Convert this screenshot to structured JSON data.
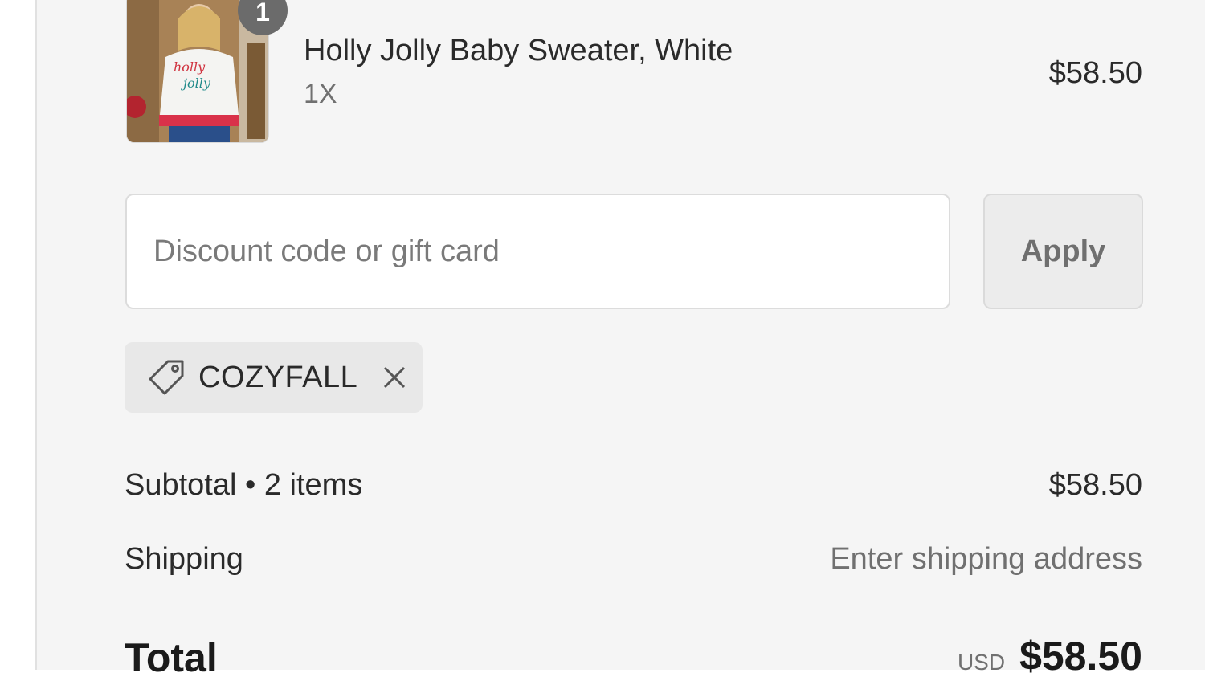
{
  "product": {
    "quantity": "1",
    "name": "Holly Jolly Baby Sweater, White",
    "variant": "1X",
    "price": "$58.50",
    "image_icon": "sweater-photo"
  },
  "discount": {
    "placeholder": "Discount code or gift card",
    "value": "",
    "apply_label": "Apply",
    "applied_code": "COZYFALL"
  },
  "summary": {
    "subtotal_label": "Subtotal • 2 items",
    "subtotal_value": "$58.50",
    "shipping_label": "Shipping",
    "shipping_value": "Enter shipping address",
    "total_label": "Total",
    "total_currency": "USD",
    "total_value": "$58.50"
  },
  "colors": {
    "panel_background": "#f5f5f5",
    "chip_background": "#e8e8e8",
    "badge_background": "#6b6b6b"
  }
}
